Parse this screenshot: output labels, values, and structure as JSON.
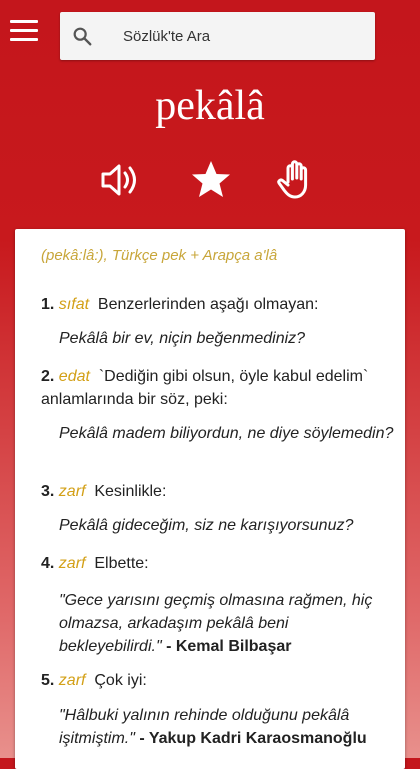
{
  "search": {
    "placeholder": "Sözlük'te Ara"
  },
  "entry": {
    "word": "pekâlâ",
    "etymology": "(pekâ:lâ:), Türkçe pek + Arapça a'lâ",
    "senses": [
      {
        "num": "1.",
        "pos": "sıfat",
        "definition": "Benzerlerinden aşağı olmayan:",
        "example": "Pekâlâ bir ev, niçin beğenmediniz?",
        "author": ""
      },
      {
        "num": "2.",
        "pos": "edat",
        "definition": "`Dediğin gibi olsun, öyle kabul edelim` anlamlarında bir söz, peki:",
        "example": "Pekâlâ madem biliyordun, ne diye söylemedin?",
        "author": ""
      },
      {
        "num": "3.",
        "pos": "zarf",
        "definition": "Kesinlikle:",
        "example": "Pekâlâ gideceğim, siz ne karışıyorsunuz?",
        "author": ""
      },
      {
        "num": "4.",
        "pos": "zarf",
        "definition": "Elbette:",
        "example": "\"Gece yarısını geçmiş olmasına rağmen, hiç olmazsa, arkadaşım pekâlâ beni bekleyebilirdi.\"",
        "author": "- Kemal Bilbaşar"
      },
      {
        "num": "5.",
        "pos": "zarf",
        "definition": "Çok iyi:",
        "example": "\"Hâlbuki yalının rehinde olduğunu pekâlâ işitmiştim.\"",
        "author": "- Yakup Kadri Karaosmanoğlu"
      }
    ]
  },
  "icons": {
    "menu": "hamburger-menu-icon",
    "search": "search-icon",
    "speaker": "speaker-icon",
    "favorite": "star-icon",
    "sign": "hand-icon"
  },
  "colors": {
    "header": "#c4161c",
    "pos": "#d3a017",
    "etymology": "#c8a63a"
  }
}
